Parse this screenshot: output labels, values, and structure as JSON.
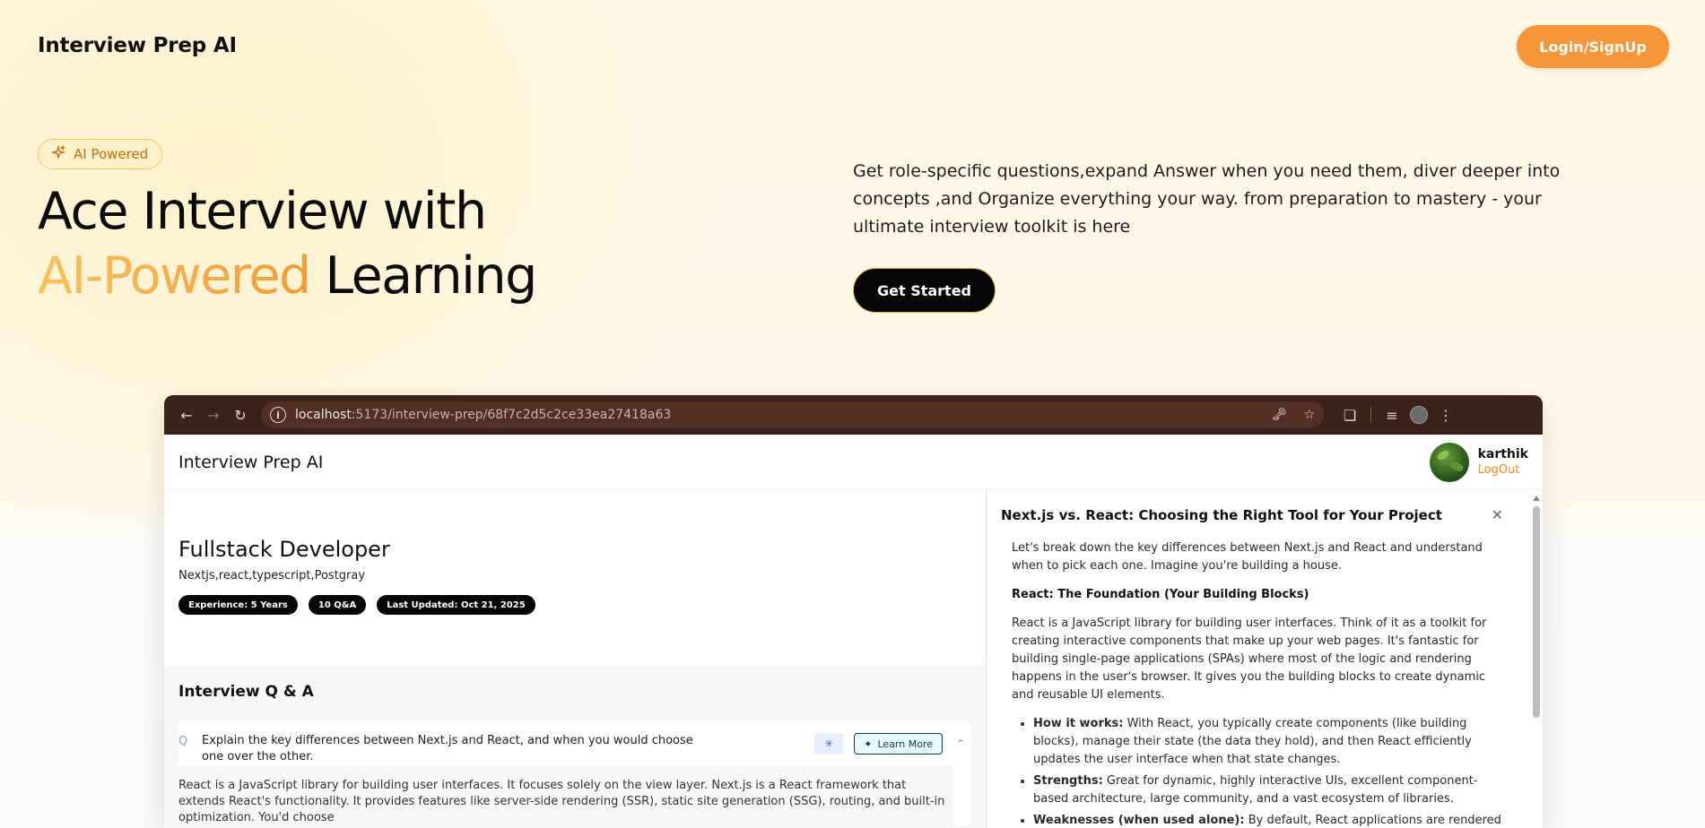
{
  "nav": {
    "title": "Interview Prep AI",
    "login_label": "Login/SignUp"
  },
  "hero": {
    "badge": "AI Powered",
    "line1": "Ace Interview with",
    "highlight": "AI-Powered",
    "line2_rest": "Learning",
    "description": "Get role-specific questions,expand Answer when you need them, diver deeper into concepts ,and Organize everything your way. from preparation to mastery - your ultimate interview toolkit is here",
    "cta": "Get Started"
  },
  "browser": {
    "url_host": "localhost",
    "url_path": ":5173/interview-prep/68f7c2d5c2ce33ea27418a63"
  },
  "app": {
    "title": "Interview Prep AI",
    "user": {
      "name": "karthik",
      "logout": "LogOut"
    },
    "role": {
      "title": "Fullstack Developer",
      "topics": "Nextjs,react,typescript,Postgray",
      "pills": [
        "Experience: 5 Years",
        "10 Q&A",
        "Last Updated: Oct 21, 2025"
      ]
    },
    "qa": {
      "heading": "Interview Q & A",
      "q_mark": "Q",
      "question": "Explain the key differences between Next.js and React, and when you would choose one over the other.",
      "learn_more": "Learn More",
      "answer": "React is a JavaScript library for building user interfaces. It focuses solely on the view layer. Next.js is a React framework that extends React's functionality. It provides features like server-side rendering (SSR), static site generation (SSG), routing, and built-in optimization. You'd choose"
    },
    "drawer": {
      "title": "Next.js vs. React: Choosing the Right Tool for Your Project",
      "intro": "Let's break down the key differences between Next.js and React and understand when to pick each one. Imagine you're building a house.",
      "section1": "React: The Foundation (Your Building Blocks)",
      "para1": "React is a JavaScript library for building user interfaces. Think of it as a toolkit for creating interactive components that make up your web pages. It's fantastic for building single-page applications (SPAs) where most of the logic and rendering happens in the user's browser. It gives you the building blocks to create dynamic and reusable UI elements.",
      "bullets": [
        {
          "label": "How it works:",
          "text": " With React, you typically create components (like building blocks), manage their state (the data they hold), and then React efficiently updates the user interface when that state changes."
        },
        {
          "label": "Strengths:",
          "text": " Great for dynamic, highly interactive UIs, excellent component-based architecture, large community, and a vast ecosystem of libraries."
        },
        {
          "label": "Weaknesses (when used alone):",
          "text": " By default, React applications are rendered on the"
        }
      ]
    }
  },
  "colors": {
    "accent": "#f7953a",
    "dark": "#050505",
    "chrome": "#3c2319"
  }
}
